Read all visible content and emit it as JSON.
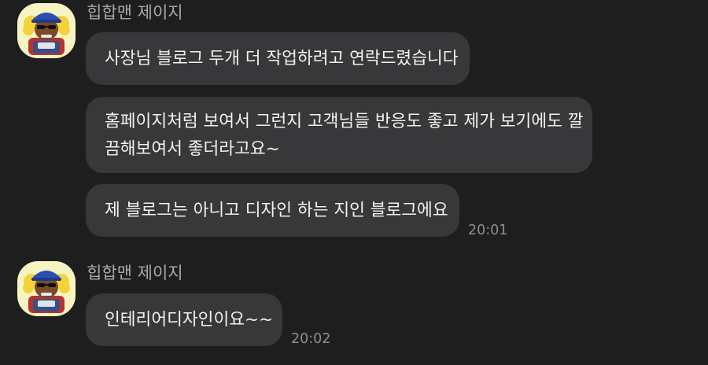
{
  "groups": [
    {
      "sender": "힙합맨 제이지",
      "avatar_icon": "hiphop-character-avatar-icon",
      "messages": [
        {
          "lines": [
            "사장님 블로그 두개 더 작업하려고 연락드렸습니다"
          ]
        },
        {
          "lines": [
            "홈페이지처럼 보여서 그런지 고객님들 반응도 좋고 제가 보기에도 깔",
            "끔해보여서 좋더라고요~"
          ]
        },
        {
          "lines": [
            "제 블로그는 아니고 디자인 하는 지인 블로그에요"
          ],
          "time": "20:01"
        }
      ]
    },
    {
      "sender": "힙합맨 제이지",
      "avatar_icon": "hiphop-character-avatar-icon",
      "messages": [
        {
          "lines": [
            "인테리어디자인이요~~"
          ],
          "time": "20:02"
        }
      ]
    }
  ],
  "colors": {
    "background": "#1e1e1f",
    "bubble": "#38383a",
    "avatar_background": "#f7f4c4"
  }
}
